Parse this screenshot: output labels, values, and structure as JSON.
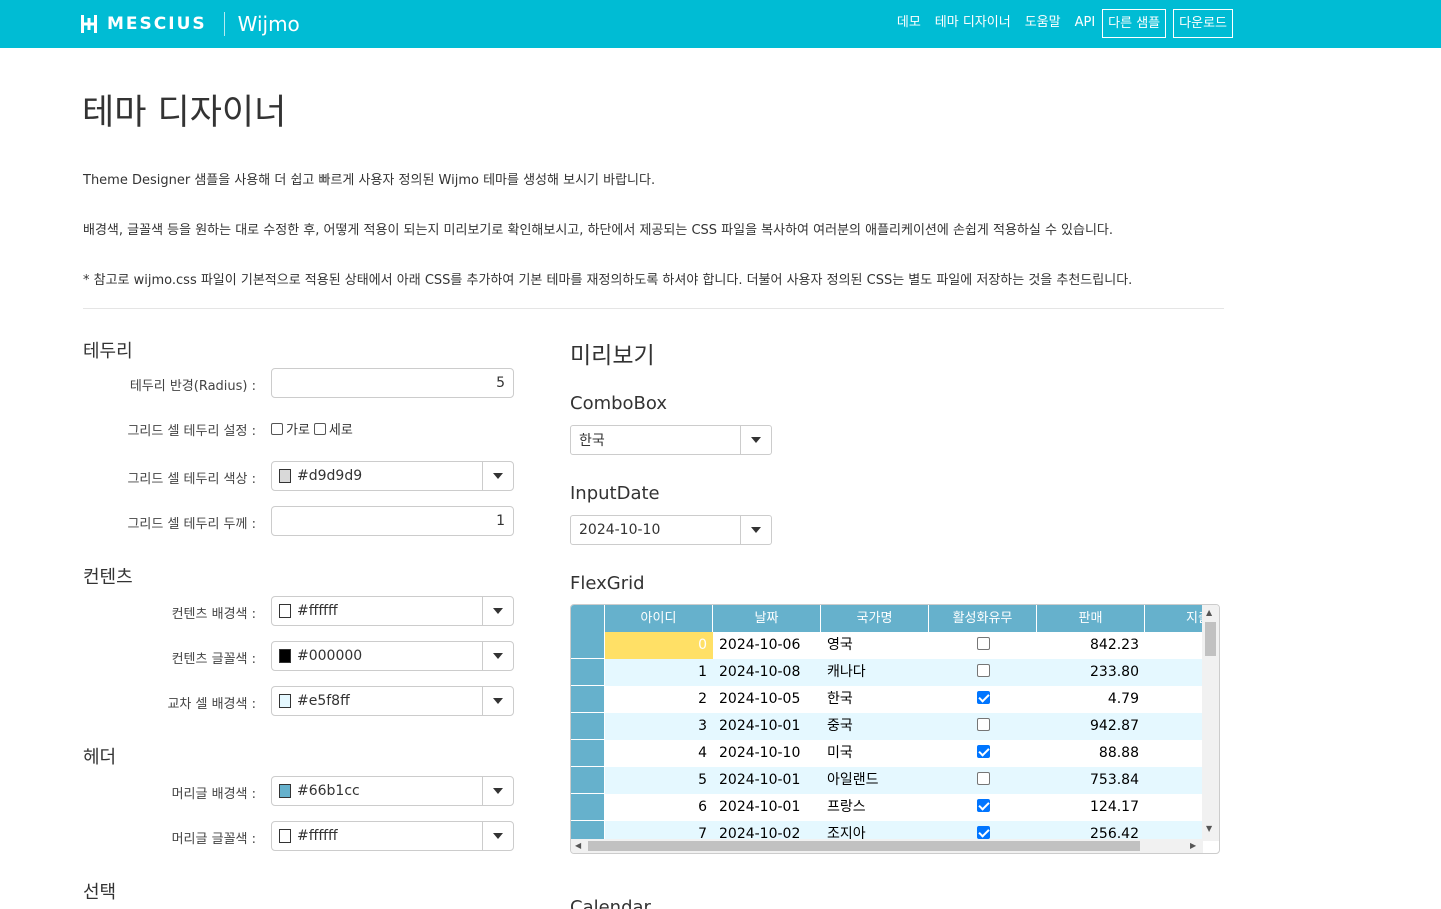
{
  "brand": {
    "company": "MESCIUS",
    "product": "Wijmo"
  },
  "nav": {
    "items": [
      "데모",
      "테마 디자이너",
      "도움말",
      "API"
    ],
    "boxed": [
      "다른 샘플",
      "다운로드"
    ]
  },
  "page": {
    "title": "테마 디자이너",
    "intro1": "Theme Designer 샘플을 사용해 더 쉽고 빠르게 사용자 정의된 Wijmo 테마를 생성해 보시기 바랍니다.",
    "intro2": "배경색, 글꼴색 등을 원하는 대로 수정한 후, 어떻게 적용이 되는지 미리보기로 확인해보시고, 하단에서 제공되는 CSS 파일을 복사하여 여러분의 애플리케이션에 손쉽게 적용하실 수 있습니다.",
    "intro3": "* 참고로 wijmo.css 파일이 기본적으로 적용된 상태에서 아래 CSS를 추가하여 기본 테마를 재정의하도록 하셔야 합니다. 더불어 사용자 정의된 CSS는 별도 파일에 저장하는 것을 추천드립니다."
  },
  "border": {
    "title": "테두리",
    "radius_label": "테두리 반경(Radius) :",
    "radius_value": "5",
    "cell_border_label": "그리드 셀 테두리 설정 :",
    "horizontal_label": "가로",
    "vertical_label": "세로",
    "cell_border_color_label": "그리드 셀 테두리 색상 :",
    "cell_border_color": "#d9d9d9",
    "cell_border_width_label": "그리드 셀 테두리 두께 :",
    "cell_border_width": "1"
  },
  "content": {
    "title": "컨텐츠",
    "bg_label": "컨텐츠 배경색 :",
    "bg": "#ffffff",
    "fg_label": "컨텐츠 글꼴색 :",
    "fg": "#000000",
    "alt_label": "교차 셀 배경색 :",
    "alt": "#e5f8ff"
  },
  "header": {
    "title": "헤더",
    "bg_label": "머리글 배경색 :",
    "bg": "#66b1cc",
    "fg_label": "머리글 글꼴색 :",
    "fg": "#ffffff"
  },
  "selection": {
    "title": "선택"
  },
  "preview": {
    "title": "미리보기",
    "combobox_title": "ComboBox",
    "combobox_value": "한국",
    "inputdate_title": "InputDate",
    "inputdate_value": "2024-10-10",
    "flexgrid_title": "FlexGrid",
    "calendar_title": "Calendar"
  },
  "grid": {
    "columns": [
      "아이디",
      "날짜",
      "국가명",
      "활성화유무",
      "판매",
      "지출"
    ],
    "rows": [
      {
        "id": "0",
        "date": "2024-10-06",
        "country": "영국",
        "active": false,
        "sales": "842.23"
      },
      {
        "id": "1",
        "date": "2024-10-08",
        "country": "캐나다",
        "active": false,
        "sales": "233.80"
      },
      {
        "id": "2",
        "date": "2024-10-05",
        "country": "한국",
        "active": true,
        "sales": "4.79"
      },
      {
        "id": "3",
        "date": "2024-10-01",
        "country": "중국",
        "active": false,
        "sales": "942.87"
      },
      {
        "id": "4",
        "date": "2024-10-10",
        "country": "미국",
        "active": true,
        "sales": "88.88"
      },
      {
        "id": "5",
        "date": "2024-10-01",
        "country": "아일랜드",
        "active": false,
        "sales": "753.84"
      },
      {
        "id": "6",
        "date": "2024-10-01",
        "country": "프랑스",
        "active": true,
        "sales": "124.17"
      },
      {
        "id": "7",
        "date": "2024-10-02",
        "country": "조지아",
        "active": true,
        "sales": "256.42"
      }
    ]
  },
  "colors": {
    "topbar": "#00bcd4",
    "grid_header": "#66b1cc",
    "grid_alt": "#e5f8ff",
    "grid_selected": "#ffe066"
  }
}
